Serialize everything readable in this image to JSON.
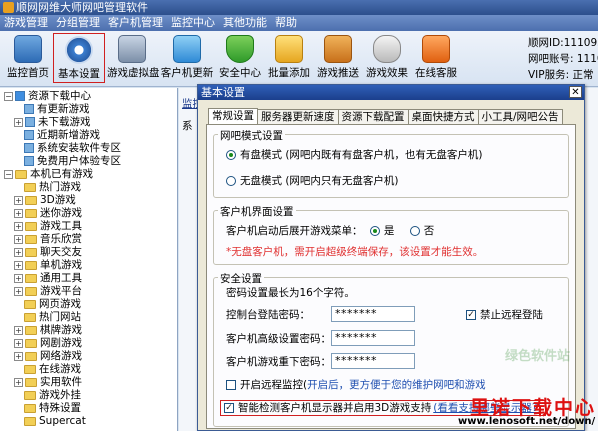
{
  "window": {
    "title": "顺网网维大师网吧管理软件"
  },
  "menu": [
    "游戏管理",
    "分组管理",
    "客户机管理",
    "监控中心",
    "其他功能",
    "帮助"
  ],
  "toolbar": [
    {
      "label": "监控首页",
      "icon": "monitor-icon"
    },
    {
      "label": "基本设置",
      "icon": "gear-icon",
      "selected": true
    },
    {
      "label": "游戏虚拟盘",
      "icon": "disk-icon"
    },
    {
      "label": "客户机更新",
      "icon": "computer-update-icon"
    },
    {
      "label": "安全中心",
      "icon": "shield-icon"
    },
    {
      "label": "批量添加",
      "icon": "folder-add-icon"
    },
    {
      "label": "游戏推送",
      "icon": "push-icon"
    },
    {
      "label": "游戏效果",
      "icon": "gamepad-icon"
    },
    {
      "label": "在线客服",
      "icon": "chat-icon"
    }
  ],
  "account": {
    "line1": "顺网ID:111095",
    "line2": "网吧账号: 1110",
    "line3": "VIP服务: 正常"
  },
  "tree": [
    "资源下载中心",
    "有更新游戏",
    "未下载游戏",
    "近期新增游戏",
    "系统安装软件专区",
    "免费用户体验专区",
    "本机已有游戏",
    "热门游戏",
    "3D游戏",
    "迷你游戏",
    "游戏工具",
    "音乐欣赏",
    "聊天交友",
    "单机游戏",
    "通用工具",
    "游戏平台",
    "网页游戏",
    "热门网站",
    "棋牌游戏",
    "网剧游戏",
    "网络游戏",
    "在线游戏",
    "实用软件",
    "游戏外挂",
    "特殊设置",
    "Supercat"
  ],
  "right_panel": {
    "tab_stub": "监控",
    "tab_stub2": "监控",
    "item_stub": "系"
  },
  "dialog": {
    "title": "基本设置",
    "tabs": [
      "常规设置",
      "服务器更新速度",
      "资源下载配置",
      "桌面快捷方式",
      "小工具/网吧公告"
    ],
    "group1": {
      "legend": "网吧模式设置",
      "option1": "有盘模式 (网吧内既有有盘客户机，也有无盘客户机)",
      "option2": "无盘模式 (网吧内只有无盘客户机)"
    },
    "group2": {
      "legend": "客户机界面设置",
      "label": "客户机启动后展开游戏菜单：",
      "yes": "是",
      "no": "否",
      "warning": "*无盘客户机，需开启超级终端保存，该设置才能生效。"
    },
    "group3": {
      "legend": "安全设置",
      "note": "密码设置最长为16个字符。",
      "pwd1_label": "控制台登陆密码：",
      "pwd1_value": "*******",
      "remote_login": "禁止远程登陆",
      "pwd2_label": "客户机高级设置密码：",
      "pwd2_value": "*******",
      "pwd3_label": "客户机游戏重下密码：",
      "pwd3_value": "*******",
      "remote_monitor_prefix": "开启远程监控(",
      "remote_monitor_blue": "开启后，更方便于您的维护网吧和游戏",
      "smart_detect": "智能检测客户机显示器并启用3D游戏支持",
      "smart_detect_link": "(看看支持哪些显示器?)"
    }
  },
  "watermark": {
    "text": "里诺下载中心",
    "url": "www.lenosoft.net/down/",
    "soft": "绿色软件站"
  }
}
